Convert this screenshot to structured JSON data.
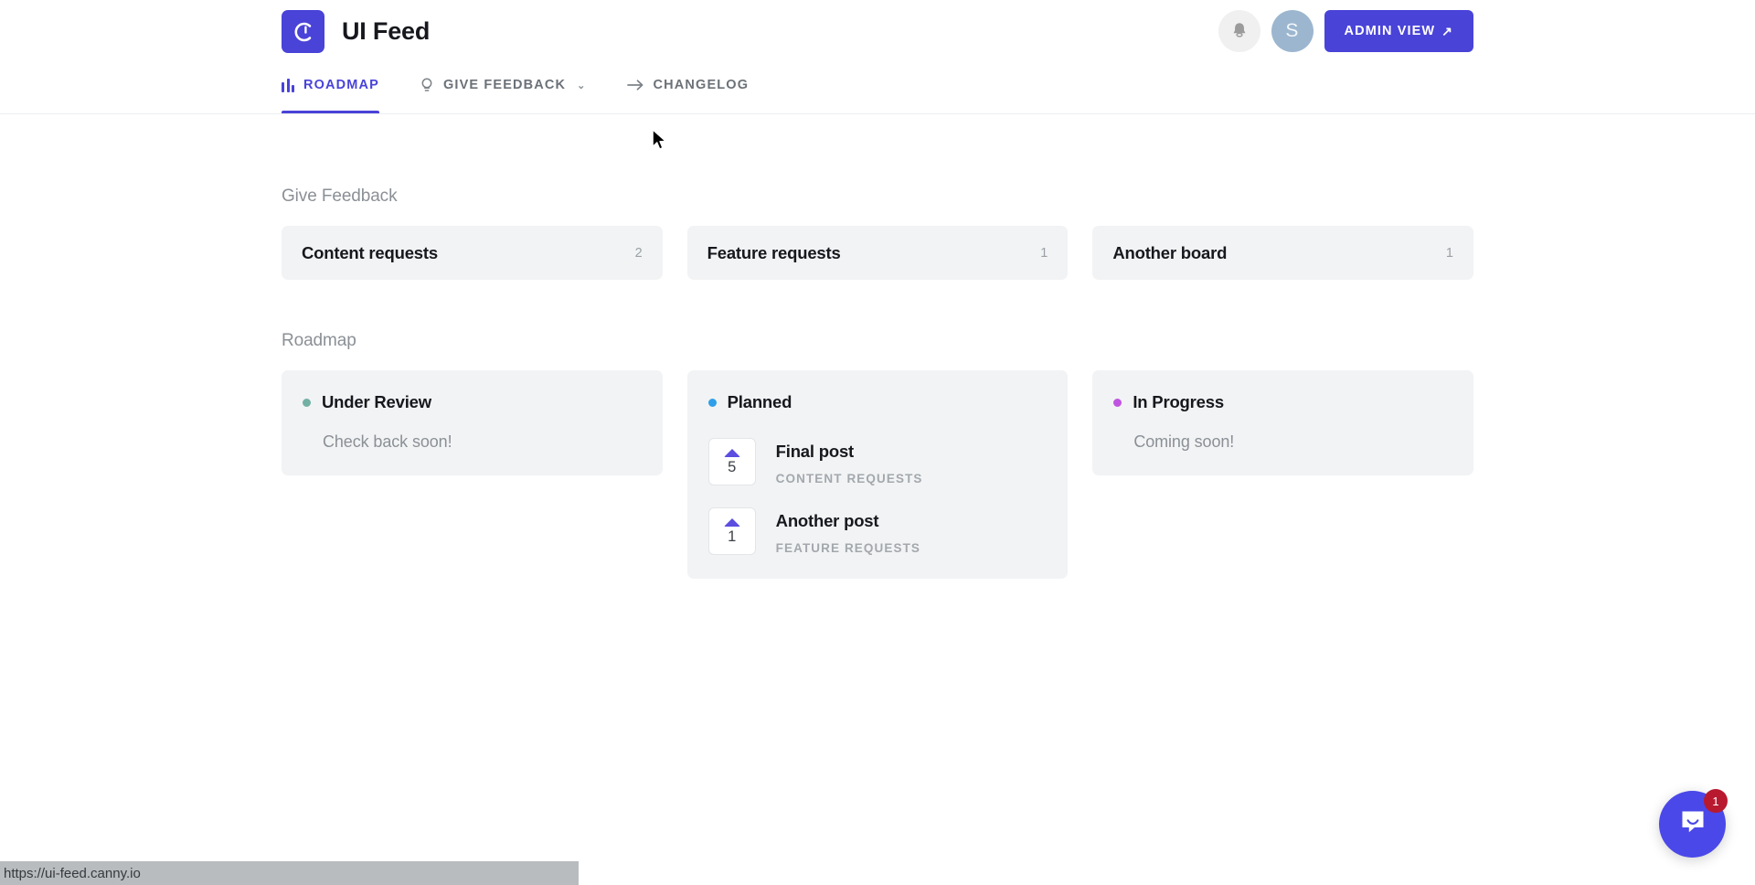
{
  "header": {
    "logo_icon": "canny-c-logo-icon",
    "title": "UI Feed",
    "brand_color": "#4943d8",
    "bell_icon": "bell-icon",
    "avatar_initial": "S",
    "avatar_color": "#9cb6cf",
    "admin_button": {
      "label": "ADMIN VIEW",
      "arrow": "↗"
    },
    "tabs": [
      {
        "label": "ROADMAP",
        "icon": "roadmap-bars-icon",
        "active": true,
        "caret": ""
      },
      {
        "label": "GIVE FEEDBACK",
        "icon": "lightbulb-icon",
        "active": false,
        "caret": "⌄"
      },
      {
        "label": "CHANGELOG",
        "icon": "arrow-right-icon",
        "active": false,
        "caret": ""
      }
    ]
  },
  "give_feedback": {
    "section_title": "Give Feedback",
    "boards": [
      {
        "name": "Content requests",
        "count": "2"
      },
      {
        "name": "Feature requests",
        "count": "1"
      },
      {
        "name": "Another board",
        "count": "1"
      }
    ]
  },
  "roadmap": {
    "section_title": "Roadmap",
    "columns": [
      {
        "title": "Under Review",
        "dot_color": "#72b0a4",
        "empty_text": "Check back soon!",
        "posts": []
      },
      {
        "title": "Planned",
        "dot_color": "#2e9fe8",
        "empty_text": "",
        "posts": [
          {
            "title": "Final post",
            "board": "CONTENT REQUESTS",
            "votes": "5"
          },
          {
            "title": "Another post",
            "board": "FEATURE REQUESTS",
            "votes": "1"
          }
        ]
      },
      {
        "title": "In Progress",
        "dot_color": "#c054e0",
        "empty_text": "Coming soon!",
        "posts": []
      }
    ]
  },
  "intercom": {
    "icon": "intercom-chat-icon",
    "badge": "1",
    "color": "#4a48e8"
  },
  "statusbar": {
    "url": "https://ui-feed.canny.io"
  }
}
